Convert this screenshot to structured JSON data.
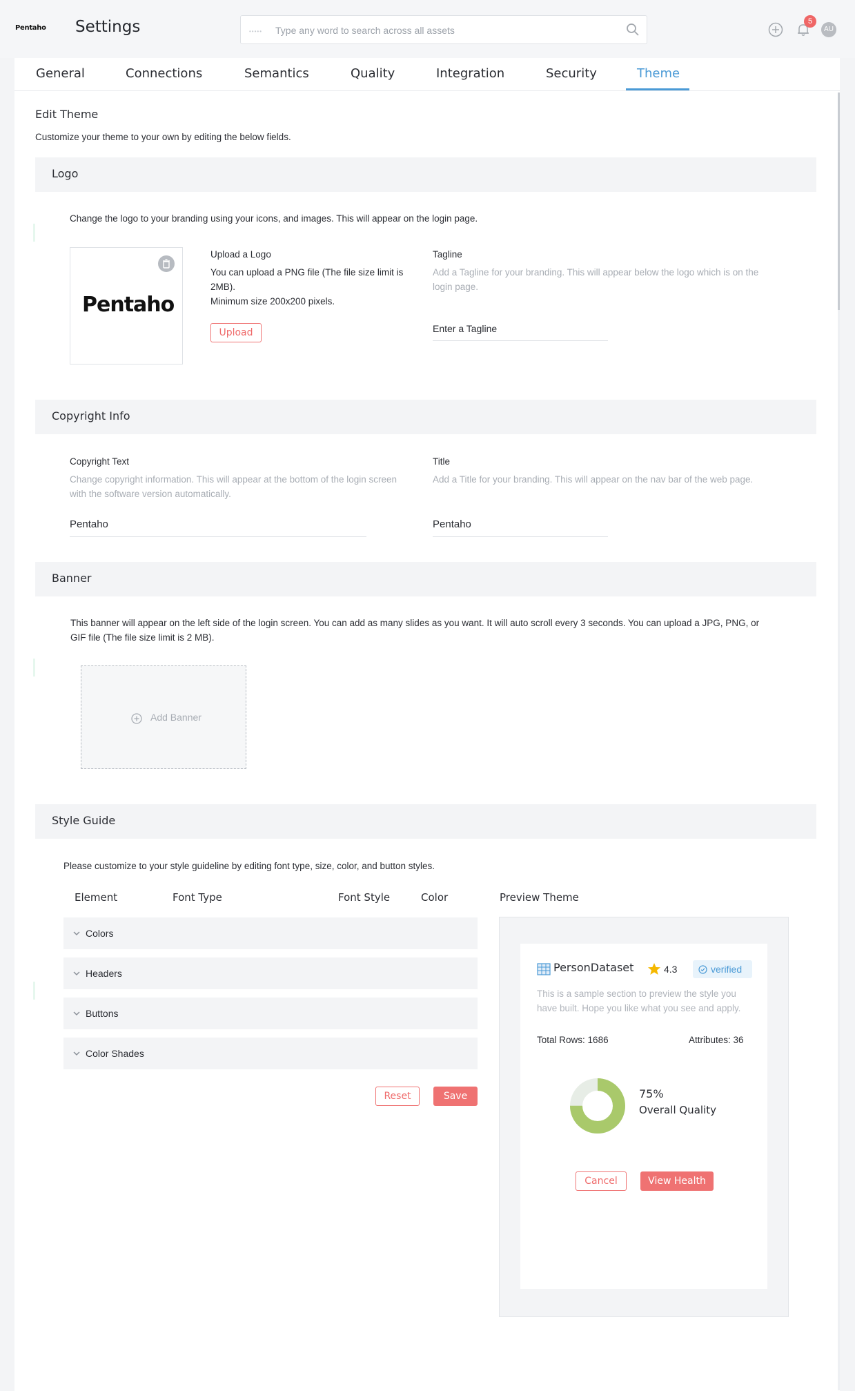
{
  "header": {
    "brand": "Pentaho",
    "title": "Settings",
    "search_placeholder": "Type any word to search across all assets",
    "notification_count": "5",
    "avatar_initials": "AU"
  },
  "tabs": [
    {
      "label": "General"
    },
    {
      "label": "Connections"
    },
    {
      "label": "Semantics"
    },
    {
      "label": "Quality"
    },
    {
      "label": "Integration"
    },
    {
      "label": "Security"
    },
    {
      "label": "Theme",
      "active": true
    }
  ],
  "edit_theme": {
    "title": "Edit Theme",
    "subtitle": "Customize your theme to your own by editing the below fields."
  },
  "logo": {
    "section_title": "Logo",
    "description": "Change the logo to your branding using your icons, and images. This will appear on the login page.",
    "logo_text": "Pentaho",
    "upload_title": "Upload a Logo",
    "upload_desc_1": "You can upload a PNG file (The file size limit is",
    "upload_desc_2": "2MB).",
    "upload_desc_3": "Minimum size 200x200 pixels.",
    "upload_button": "Upload",
    "tagline_label": "Tagline",
    "tagline_help_1": "Add a Tagline for your branding. This will appear below the logo which is on the",
    "tagline_help_2": "login page.",
    "tagline_value": "Enter a Tagline"
  },
  "copyright": {
    "section_title": "Copyright Info",
    "copyright_label": "Copyright Text",
    "copyright_help_1": "Change copyright information. This will appear at the bottom of the login screen",
    "copyright_help_2": "with the software version automatically.",
    "copyright_value": "Pentaho",
    "title_label": "Title",
    "title_help": "Add a Title for your branding. This will appear on the nav bar of the web page.",
    "title_value": "Pentaho"
  },
  "banner": {
    "section_title": "Banner",
    "description_1": "This banner will appear on the left side of the login screen. You can add as many slides as you want. It will auto scroll every 3 seconds. You can upload a JPG, PNG, or",
    "description_2": "GIF file (The file size limit is 2 MB).",
    "add_label": "Add Banner"
  },
  "style_guide": {
    "section_title": "Style Guide",
    "description": "Please customize to your style guideline by editing font type, size, color, and button styles.",
    "columns": [
      "Element",
      "Font Type",
      "Font Style",
      "Color"
    ],
    "preview_title": "Preview Theme",
    "rows": [
      "Colors",
      "Headers",
      "Buttons",
      "Color Shades"
    ],
    "reset_button": "Reset",
    "save_button": "Save"
  },
  "preview": {
    "dataset_name": "PersonDataset",
    "rating": "4.3",
    "verified_label": "verified",
    "desc_1": "This is a sample section to preview the style you",
    "desc_2": "have built. Hope you like what you see and apply.",
    "total_rows_label": "Total Rows:",
    "total_rows_value": "1686",
    "attributes_label": "Attributes:",
    "attributes_value": "36",
    "quality_value": "75%",
    "quality_fraction": 0.75,
    "quality_label": "Overall Quality",
    "cancel_button": "Cancel",
    "view_health_button": "View Health"
  },
  "colors": {
    "accent_blue": "#4a9ad6",
    "accent_red": "#ef7272",
    "donut_green": "#a9c96b",
    "donut_track": "#e7ede6",
    "star": "#f5b800"
  }
}
